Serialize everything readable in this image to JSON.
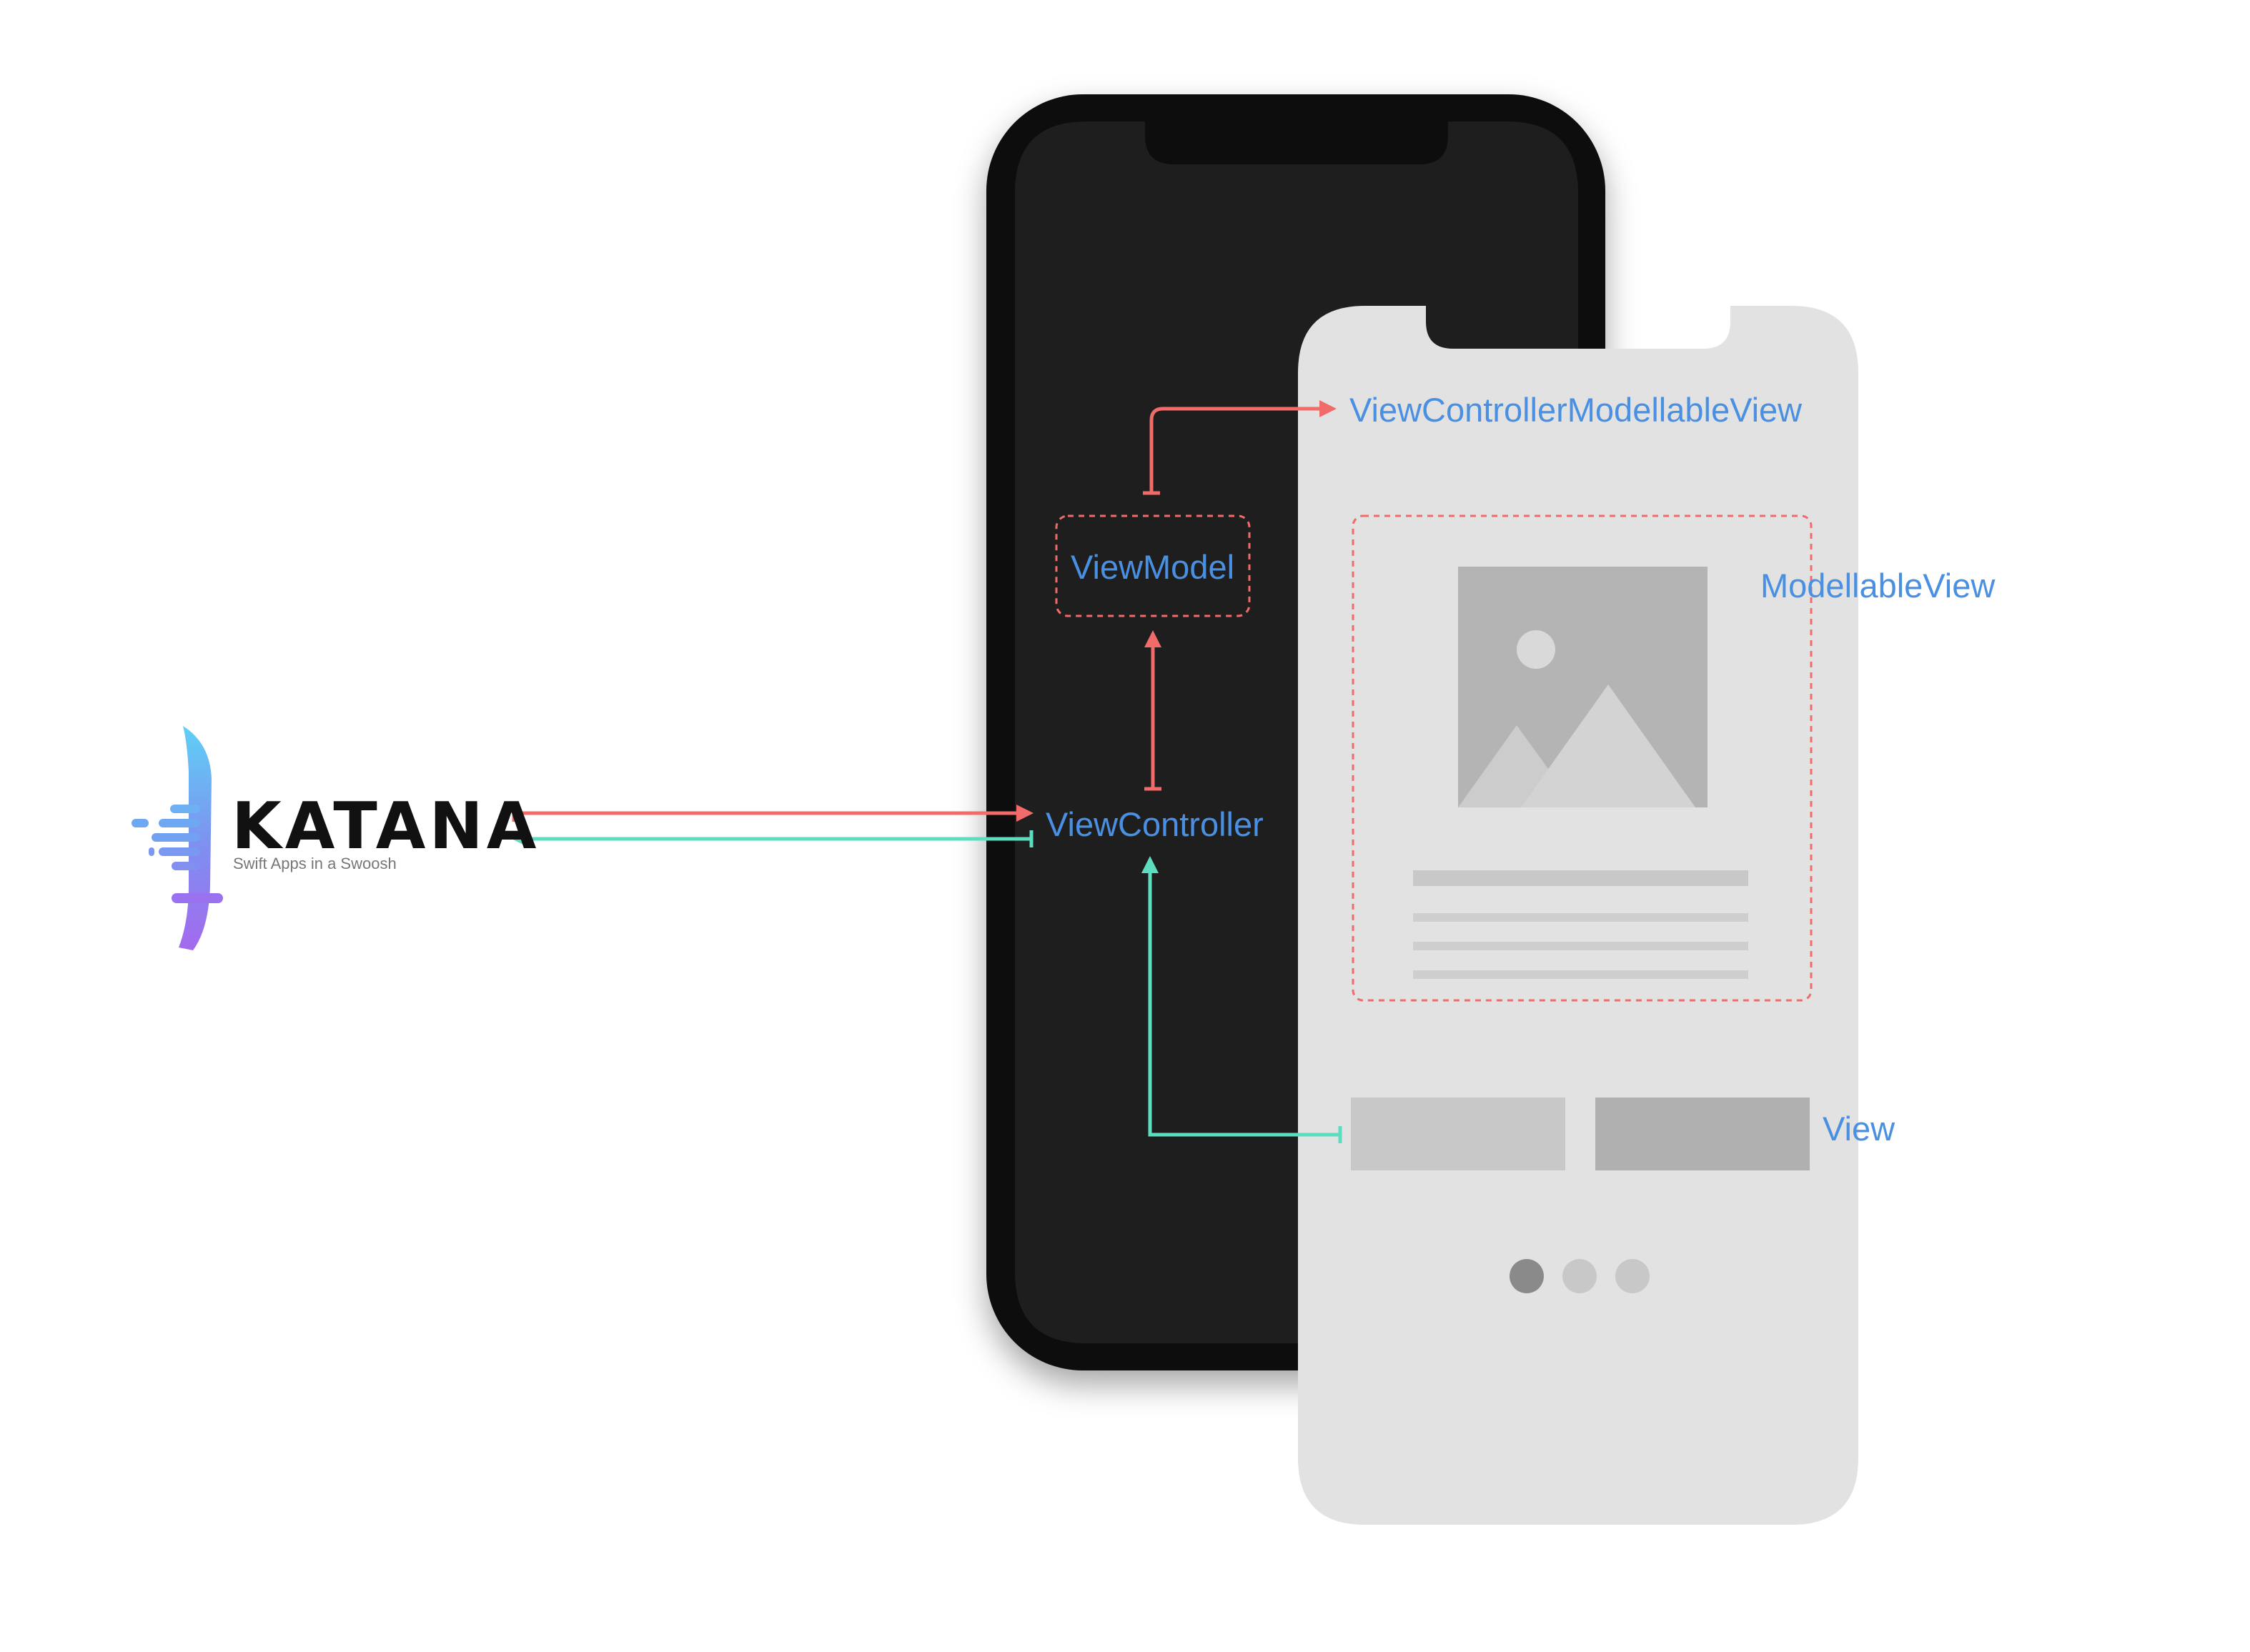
{
  "logo": {
    "wordmark": "KATANA",
    "tagline": "Swift Apps in a Swoosh"
  },
  "labels": {
    "view_controller_modellable_view": "ViewControllerModellableView",
    "view_model": "ViewModel",
    "modellable_view": "ModellableView",
    "view_controller": "ViewController",
    "view": "View"
  },
  "pager": {
    "total_pages": 3,
    "current_page": 1
  },
  "colors": {
    "label_blue": "#4a90e2",
    "arrow_red": "#f26b6b",
    "arrow_teal": "#5dddc0",
    "dark_phone_frame": "#0d0d0d",
    "dark_phone_screen": "#1e1e1e",
    "light_phone": "#e2e2e2",
    "placeholder_gray": "#b3b4b3"
  },
  "icons": {
    "logo_mark": "katana-blade-icon",
    "image_placeholder": "image-placeholder-icon"
  }
}
